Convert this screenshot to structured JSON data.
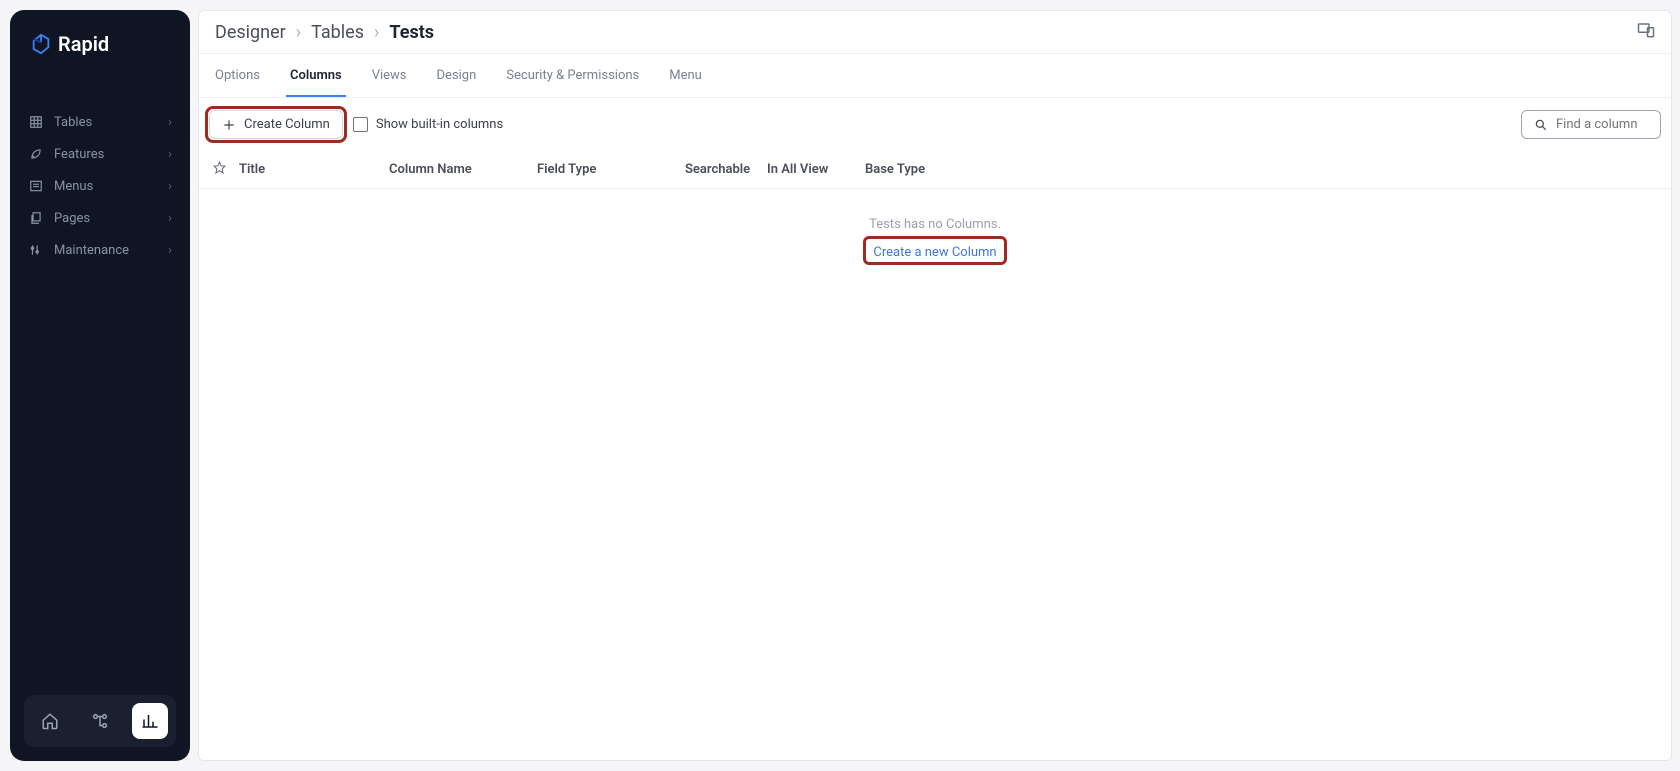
{
  "brand": {
    "name": "Rapid"
  },
  "sidebar": {
    "items": [
      {
        "label": "Tables"
      },
      {
        "label": "Features"
      },
      {
        "label": "Menus"
      },
      {
        "label": "Pages"
      },
      {
        "label": "Maintenance"
      }
    ]
  },
  "breadcrumb": {
    "root": "Designer",
    "section": "Tables",
    "current": "Tests"
  },
  "tabs": [
    {
      "label": "Options"
    },
    {
      "label": "Columns"
    },
    {
      "label": "Views"
    },
    {
      "label": "Design"
    },
    {
      "label": "Security & Permissions"
    },
    {
      "label": "Menu"
    }
  ],
  "toolbar": {
    "create_label": "Create Column",
    "show_builtin_label": "Show built-in columns",
    "search_placeholder": "Find a column"
  },
  "table": {
    "headers": {
      "title": "Title",
      "column_name": "Column Name",
      "field_type": "Field Type",
      "searchable": "Searchable",
      "in_all_view": "In All View",
      "base_type": "Base Type"
    }
  },
  "empty_state": {
    "message": "Tests has no Columns.",
    "link_label": "Create a new Column"
  }
}
